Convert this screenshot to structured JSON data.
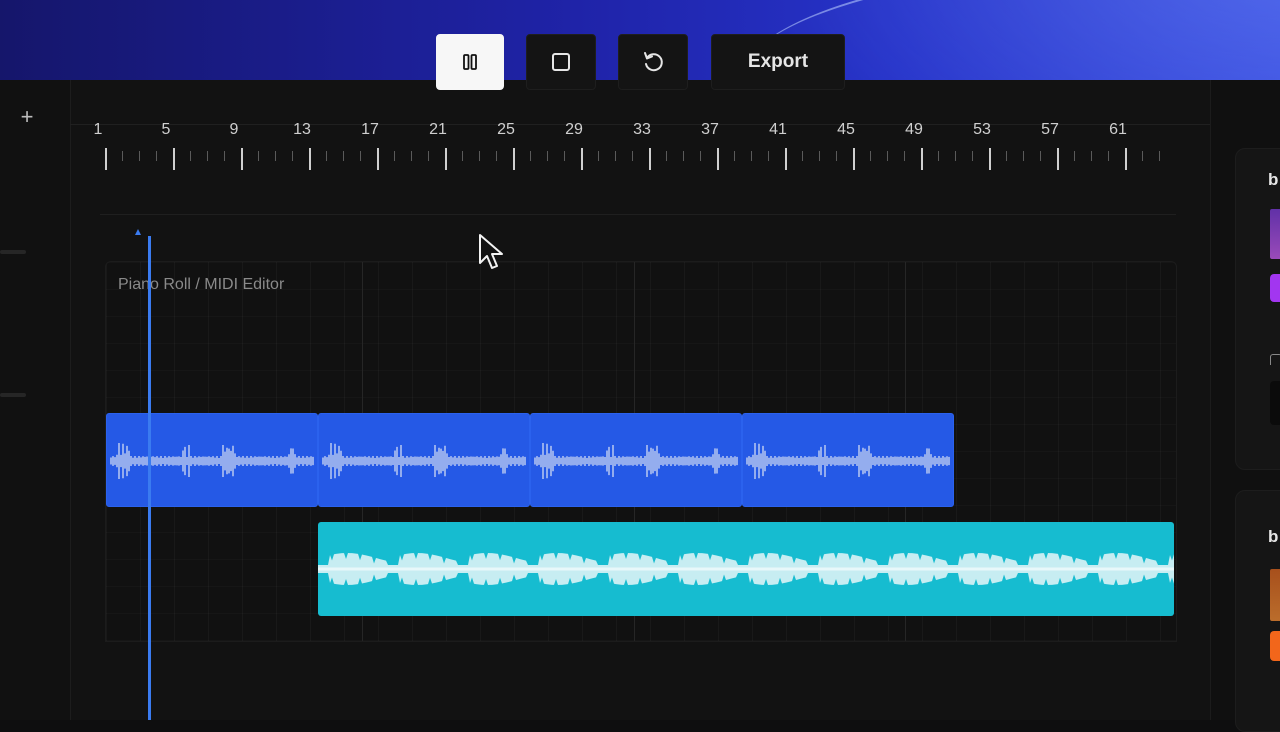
{
  "toolbar": {
    "pause_icon": "pause-icon",
    "stop_icon": "stop-icon",
    "loop_icon": "loop-icon",
    "export_label": "Export"
  },
  "ruler": {
    "bar_numbers": [
      "1",
      "5",
      "9",
      "13",
      "17",
      "21",
      "25",
      "29",
      "33",
      "37",
      "41",
      "45",
      "49",
      "53",
      "57",
      "61"
    ]
  },
  "editor": {
    "title": "Piano Roll / MIDI Editor"
  },
  "tracks": [
    {
      "name": "",
      "color": "#2559e6",
      "clips": 4
    },
    {
      "name": "",
      "color": "#16bcd0",
      "clips": 1
    }
  ],
  "right_panel": {
    "card1_letter": "b",
    "card2_letter": "b",
    "accent_colors": [
      "#a236f0",
      "#f2661b"
    ]
  },
  "left_rail": {
    "add_icon": "plus-icon"
  }
}
